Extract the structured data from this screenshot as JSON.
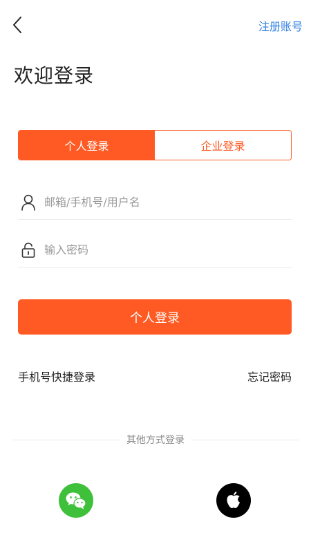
{
  "header": {
    "register_label": "注册账号"
  },
  "title": "欢迎登录",
  "tabs": [
    {
      "label": "个人登录",
      "active": true
    },
    {
      "label": "企业登录",
      "active": false
    }
  ],
  "form": {
    "username_placeholder": "邮箱/手机号/用户名",
    "password_placeholder": "输入密码"
  },
  "login_button_label": "个人登录",
  "links": {
    "quick_login": "手机号快捷登录",
    "forgot_password": "忘记密码"
  },
  "divider_text": "其他方式登录",
  "icons": {
    "back": "chevron-left-icon",
    "user": "user-icon",
    "lock": "lock-icon",
    "wechat": "wechat-icon",
    "apple": "apple-icon"
  },
  "colors": {
    "accent": "#ff5a23",
    "link": "#2b7de1",
    "wechat": "#3fc03b",
    "apple": "#000000"
  }
}
